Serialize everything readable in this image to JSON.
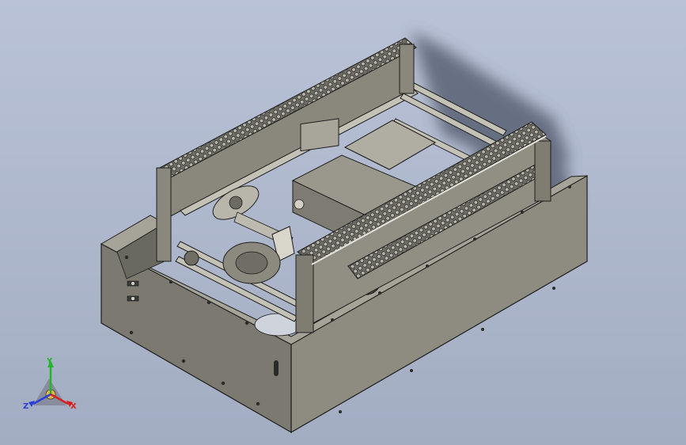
{
  "scene": {
    "description_label": "",
    "background_top": "#b9c2d6",
    "background_bottom": "#a3adc2",
    "part_color": "#8e8c80",
    "part_dark": "#5c5b54",
    "part_light": "#b4b2a6",
    "edge_color": "#1d1d1d",
    "shadow_color": "#4d5468"
  },
  "triad": {
    "x_label": "X",
    "y_label": "Y",
    "z_label": "Z",
    "x_color": "#d61f1f",
    "y_color": "#23b52a",
    "z_color": "#2b3fd6"
  }
}
